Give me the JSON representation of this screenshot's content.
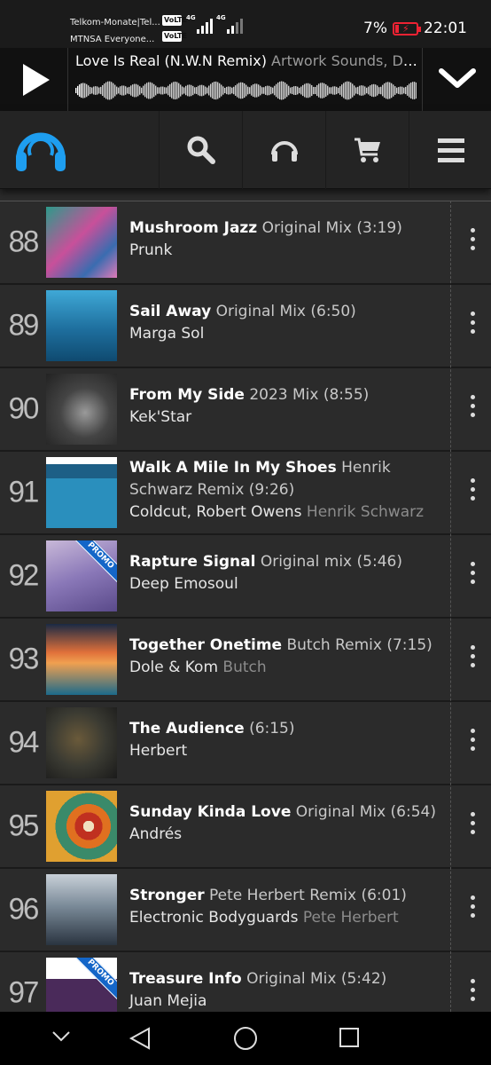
{
  "status_bar": {
    "carrier1": "Telkom-Monate|Tel...",
    "carrier2": "MTNSA Everyone...",
    "volte1": "VoLTE",
    "volte2": "VoLTE",
    "net1": "4G",
    "net2": "4G",
    "battery": "7%",
    "time": "22:01",
    "battery_color": "#e22233"
  },
  "player": {
    "track_title": "Love Is Real (N.W.N Remix)",
    "track_artists": "Artwork Sounds, Dea...",
    "play_icon": "play-icon",
    "collapse_icon": "chevron-down-icon"
  },
  "nav": {
    "logo": "headphones-logo",
    "items": [
      "search-icon",
      "headphones-icon",
      "cart-icon",
      "menu-icon"
    ],
    "accent": "#1e9ef0"
  },
  "tracks": [
    {
      "rank": "88",
      "title": "Mushroom Jazz",
      "mix": "Original Mix (3:19)",
      "artists": "Prunk",
      "remixer": ""
    },
    {
      "rank": "89",
      "title": "Sail Away",
      "mix": "Original Mix (6:50)",
      "artists": "Marga Sol",
      "remixer": ""
    },
    {
      "rank": "90",
      "title": "From My Side",
      "mix": "2023 Mix (8:55)",
      "artists": "Kek'Star",
      "remixer": ""
    },
    {
      "rank": "91",
      "title": "Walk A Mile In My Shoes",
      "mix": "Henrik Schwarz Remix (9:26)",
      "artists": "Coldcut, Robert Owens",
      "remixer": "Henrik Schwarz"
    },
    {
      "rank": "92",
      "title": "Rapture Signal",
      "mix": "Original mix (5:46)",
      "artists": "Deep Emosoul",
      "remixer": "",
      "promo": "PROMO"
    },
    {
      "rank": "93",
      "title": "Together Onetime",
      "mix": "Butch Remix (7:15)",
      "artists": "Dole & Kom",
      "remixer": "Butch"
    },
    {
      "rank": "94",
      "title": "The Audience",
      "mix": "(6:15)",
      "artists": "Herbert",
      "remixer": ""
    },
    {
      "rank": "95",
      "title": "Sunday Kinda Love",
      "mix": "Original Mix (6:54)",
      "artists": "Andrés",
      "remixer": ""
    },
    {
      "rank": "96",
      "title": "Stronger",
      "mix": "Pete Herbert Remix (6:01)",
      "artists": "Electronic Bodyguards",
      "remixer": "Pete Herbert"
    },
    {
      "rank": "97",
      "title": "Treasure Info",
      "mix": "Original Mix (5:42)",
      "artists": "Juan Mejia",
      "remixer": "",
      "promo": "PROMO"
    }
  ],
  "system_nav": [
    "chevron-down-icon",
    "back-icon",
    "home-icon",
    "recents-icon"
  ]
}
